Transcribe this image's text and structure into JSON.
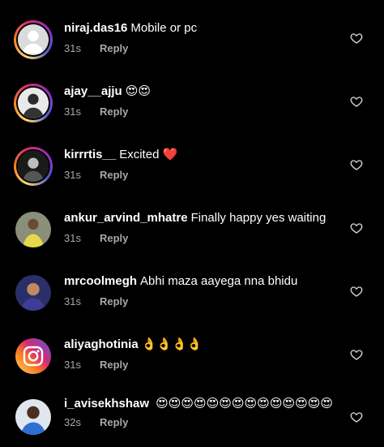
{
  "comments": [
    {
      "username": "niraj.das16",
      "text": "Mobile or pc",
      "emojis": "",
      "time": "31s",
      "reply": "Reply",
      "avatar": "default-avatar",
      "ring": "story"
    },
    {
      "username": "ajay__ajju",
      "text": "",
      "emojis": "😍😍",
      "time": "31s",
      "reply": "Reply",
      "avatar": "photo-avatar",
      "ring": "story"
    },
    {
      "username": "kirrrtis__",
      "text": "Excited",
      "emojis": "❤️",
      "time": "31s",
      "reply": "Reply",
      "avatar": "photo-avatar",
      "ring": "story"
    },
    {
      "username": "ankur_arvind_mhatre",
      "text": "Finally happy yes waiting",
      "emojis": "",
      "time": "31s",
      "reply": "Reply",
      "avatar": "photo-avatar",
      "ring": "none"
    },
    {
      "username": "mrcoolmegh",
      "text": "Abhi maza aayega nna bhidu",
      "emojis": "",
      "time": "31s",
      "reply": "Reply",
      "avatar": "photo-avatar",
      "ring": "none"
    },
    {
      "username": "aliyaghotinia",
      "text": "",
      "emojis": "👌👌👌👌",
      "time": "31s",
      "reply": "Reply",
      "avatar": "instagram-logo-avatar",
      "ring": "none"
    },
    {
      "username": "i_avisekhshaw",
      "text": "",
      "emojis": "😍😍😍😍😍😍😍😍😍😍😍😍😍😍",
      "time": "32s",
      "reply": "Reply",
      "avatar": "photo-avatar",
      "ring": "none"
    }
  ],
  "colors": {
    "background": "#000000",
    "text": "#ffffff",
    "muted": "#a8a8a8"
  },
  "icons": {
    "like": "heart-outline-icon"
  }
}
